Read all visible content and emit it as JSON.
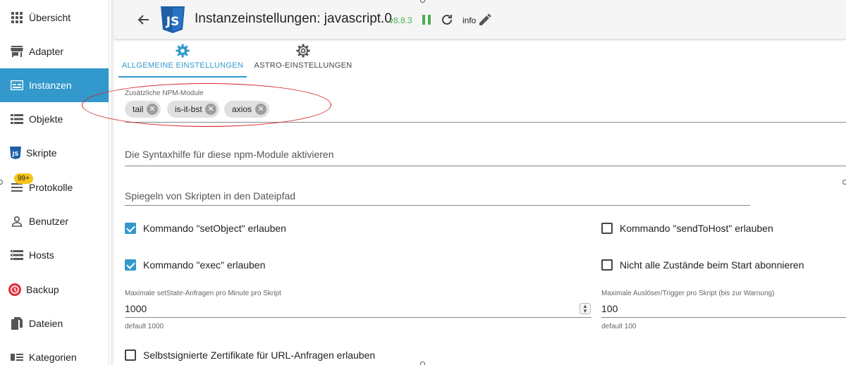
{
  "sidebar": {
    "items": [
      {
        "label": "Übersicht"
      },
      {
        "label": "Adapter"
      },
      {
        "label": "Instanzen"
      },
      {
        "label": "Objekte"
      },
      {
        "label": "Skripte"
      },
      {
        "label": "Protokolle"
      },
      {
        "label": "Benutzer"
      },
      {
        "label": "Hosts"
      },
      {
        "label": "Backup"
      },
      {
        "label": "Dateien"
      },
      {
        "label": "Kategorien"
      }
    ],
    "active": "Instanzen",
    "protokolle_badge": "99+"
  },
  "header": {
    "title": "Instanzeinstellungen: javascript.0",
    "version": "v8.8.3",
    "log_level": "info",
    "js_logo_text": "JS"
  },
  "tabs": [
    {
      "label": "ALLGEMEINE EINSTELLUNGEN",
      "selected": true
    },
    {
      "label": "ASTRO-EINSTELLUNGEN",
      "selected": false
    }
  ],
  "form": {
    "npm_modules_label": "Zusätzliche NPM-Module",
    "npm_modules": [
      "tail",
      "is-it-bst",
      "axios"
    ],
    "syntax_help_label": "Die Syntaxhilfe für diese npm-Module aktivieren",
    "mirror_label": "Spiegeln von Skripten in den Dateipfad",
    "checkboxes": {
      "set_object": {
        "label": "Kommando \"setObject\" erlauben",
        "checked": true
      },
      "send_to_host": {
        "label": "Kommando \"sendToHost\" erlauben",
        "checked": false
      },
      "exec": {
        "label": "Kommando \"exec\" erlauben",
        "checked": true
      },
      "no_subscribe": {
        "label": "Nicht alle Zustände beim Start abonnieren",
        "checked": false
      },
      "self_signed": {
        "label": "Selbstsignierte Zertifikate für URL-Anfragen erlauben",
        "checked": false
      }
    },
    "max_setstate": {
      "label": "Maximale setState-Anfragen pro Minute pro Skript",
      "value": "1000",
      "helper": "default 1000"
    },
    "max_triggers": {
      "label": "Maximale Auslöser/Trigger pro Skript (bis zur Warnung)",
      "value": "100",
      "helper": "default 100"
    }
  },
  "colors": {
    "accent": "#3399cc",
    "version_green": "#4caf50",
    "annotation_red": "#d62020"
  }
}
